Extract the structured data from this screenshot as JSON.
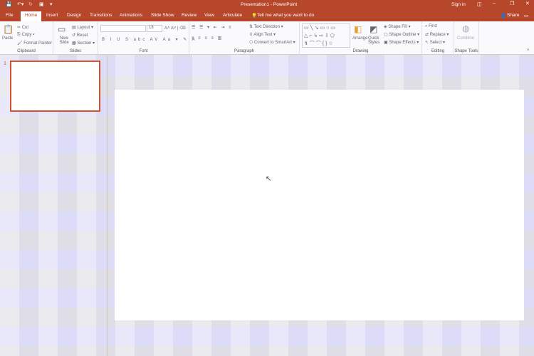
{
  "title": "Presentation1 - PowerPoint",
  "titlebar": {
    "sign_in": "Sign in",
    "share": "Share"
  },
  "tabs": [
    "File",
    "Home",
    "Insert",
    "Design",
    "Transitions",
    "Animations",
    "Slide Show",
    "Review",
    "View",
    "Articulate"
  ],
  "tell_me": "Tell me what you want to do",
  "ribbon": {
    "clipboard": {
      "label": "Clipboard",
      "paste": "Paste",
      "cut": "Cut",
      "copy": "Copy",
      "format_painter": "Format Painter"
    },
    "slides": {
      "label": "Slides",
      "new_slide": "New Slide",
      "layout": "Layout",
      "reset": "Reset",
      "section": "Section"
    },
    "font": {
      "label": "Font",
      "size": "18"
    },
    "paragraph": {
      "label": "Paragraph",
      "text_direction": "Text Direction",
      "align_text": "Align Text",
      "convert": "Convert to SmartArt"
    },
    "drawing": {
      "label": "Drawing",
      "arrange": "Arrange",
      "quick_styles": "Quick Styles",
      "shape_fill": "Shape Fill",
      "shape_outline": "Shape Outline",
      "shape_effects": "Shape Effects"
    },
    "editing": {
      "label": "Editing",
      "find": "Find",
      "replace": "Replace",
      "select": "Select"
    },
    "shape_tools": {
      "label": "Shape Tools",
      "combine": "Combine"
    }
  },
  "slide_panel": {
    "number": "1"
  }
}
